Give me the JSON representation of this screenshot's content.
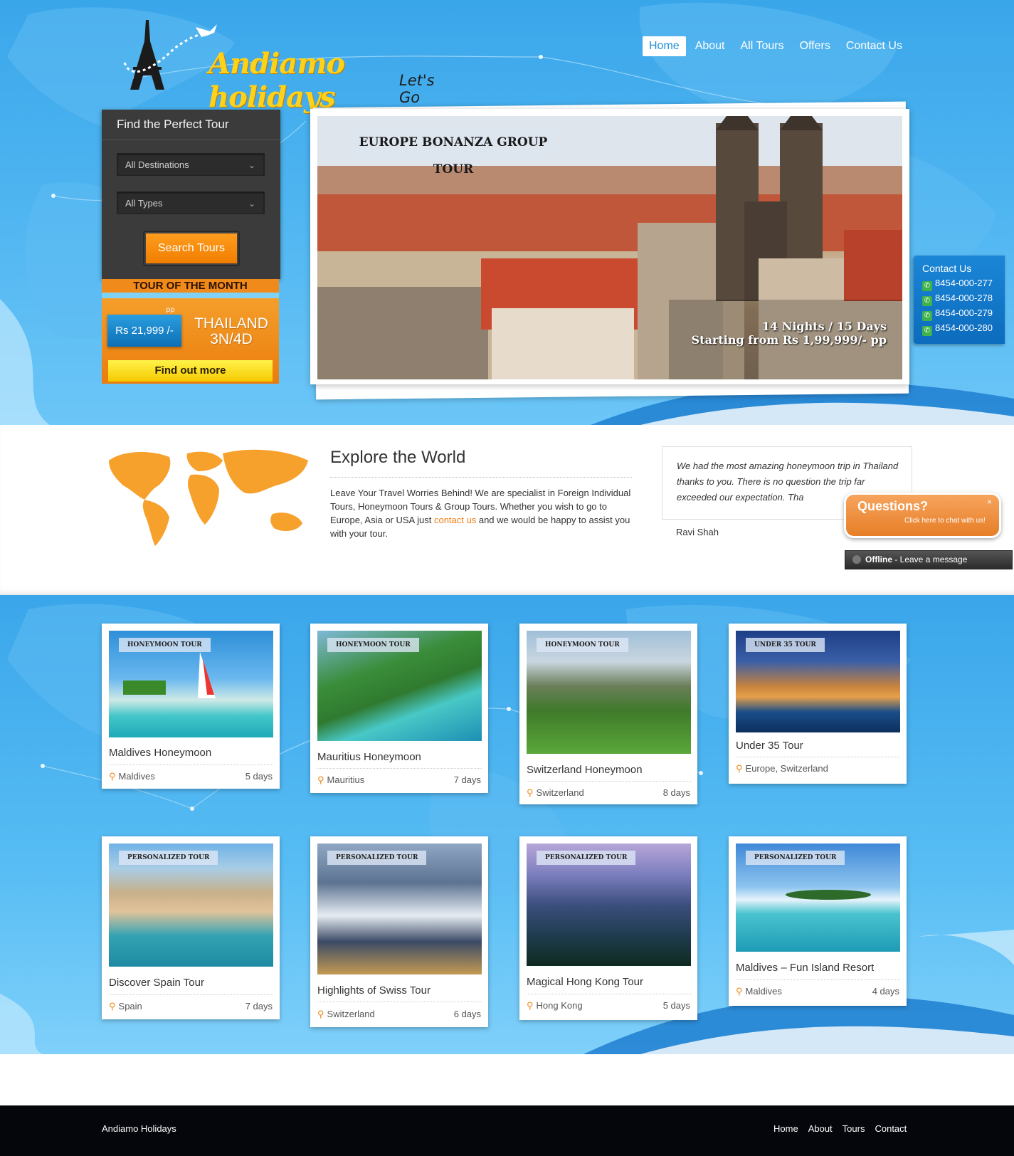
{
  "brand": {
    "name": "Andiamo holidays",
    "tagline": "Let's Go"
  },
  "nav": [
    {
      "label": "Home",
      "active": true
    },
    {
      "label": "About"
    },
    {
      "label": "All Tours"
    },
    {
      "label": "Offers"
    },
    {
      "label": "Contact Us"
    }
  ],
  "search": {
    "title": "Find the Perfect Tour",
    "destination": "All Destinations",
    "type": "All Types",
    "button": "Search Tours"
  },
  "tour_of_month": {
    "heading": "TOUR OF THE MONTH",
    "price": "Rs 21,999 /-",
    "pp": "pp",
    "dest_line1": "THAILAND",
    "dest_line2": "3N/4D",
    "button": "Find out more"
  },
  "slider": {
    "title": "EUROPE BONANZA GROUP TOUR",
    "line1": "14 Nights / 15 Days",
    "line2": "Starting from Rs 1,99,999/- pp"
  },
  "contact_widget": {
    "title": "Contact Us",
    "phones": [
      "8454-000-277",
      "8454-000-278",
      "8454-000-279",
      "8454-000-280"
    ]
  },
  "explore": {
    "title": "Explore the World",
    "text_before": "Leave Your Travel Worries Behind! We are specialist in Foreign Individual Tours, Honeymoon Tours & Group Tours. Whether you wish to go to Europe, Asia or USA just ",
    "link": "contact us",
    "text_after": " and we would be happy to assist you with your tour."
  },
  "testimonial": {
    "text": "We had the most amazing honeymoon trip in Thailand thanks to you. There is no question the trip far exceeded our expectation. Tha",
    "author": "Ravi Shah"
  },
  "chat": {
    "title": "Questions?",
    "subtitle": "Click here to chat with us!",
    "close": "×",
    "offline_bold": "Offline",
    "offline_text": " - Leave a message"
  },
  "tours": [
    {
      "tag": "HONEYMOON TOUR",
      "name": "Maldives Honeymoon",
      "location": "Maldives",
      "days": "5 days"
    },
    {
      "tag": "HONEYMOON TOUR",
      "name": "Mauritius Honeymoon",
      "location": "Mauritius",
      "days": "7 days"
    },
    {
      "tag": "HONEYMOON TOUR",
      "name": "Switzerland Honeymoon",
      "location": "Switzerland",
      "days": "8 days"
    },
    {
      "tag": "UNDER 35 TOUR",
      "name": "Under 35 Tour",
      "location": "Europe, Switzerland",
      "days": ""
    },
    {
      "tag": "PERSONALIZED TOUR",
      "name": "Discover Spain Tour",
      "location": "Spain",
      "days": "7 days"
    },
    {
      "tag": "PERSONALIZED TOUR",
      "name": "Highlights of Swiss Tour",
      "location": "Switzerland",
      "days": "6 days"
    },
    {
      "tag": "PERSONALIZED TOUR",
      "name": "Magical Hong Kong Tour",
      "location": "Hong Kong",
      "days": "5 days"
    },
    {
      "tag": "PERSONALIZED TOUR",
      "name": "Maldives – Fun Island Resort",
      "location": "Maldives",
      "days": "4 days"
    }
  ],
  "footer": {
    "brand": "Andiamo Holidays",
    "links": [
      "Home",
      "About",
      "Tours",
      "Contact"
    ]
  },
  "colors": {
    "accent_orange": "#f08a16",
    "sky_blue": "#3aa6ea",
    "dark_panel": "#3b3b3b"
  }
}
